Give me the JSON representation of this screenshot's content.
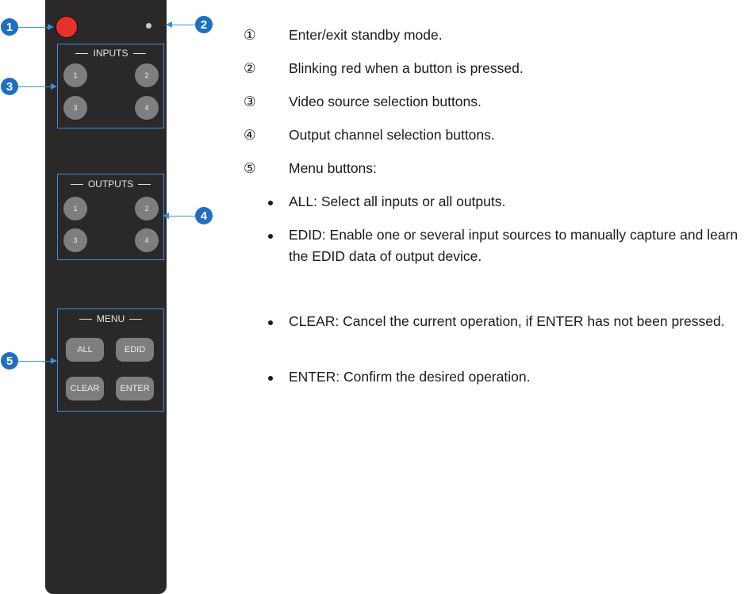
{
  "callouts": [
    "1",
    "2",
    "3",
    "4",
    "5"
  ],
  "remote": {
    "inputs_label": "INPUTS",
    "outputs_label": "OUTPUTS",
    "menu_label": "MENU",
    "input_buttons": [
      "1",
      "2",
      "3",
      "4"
    ],
    "output_buttons": [
      "1",
      "2",
      "3",
      "4"
    ],
    "menu_buttons": [
      "ALL",
      "EDID",
      "CLEAR",
      "ENTER"
    ]
  },
  "legend": {
    "items": [
      {
        "num": "①",
        "text": "Enter/exit standby mode."
      },
      {
        "num": "②",
        "text": "Blinking red when a button is pressed."
      },
      {
        "num": "③",
        "text": "Video source selection buttons."
      },
      {
        "num": "④",
        "text": "Output channel selection buttons."
      },
      {
        "num": "⑤",
        "text": "Menu buttons:"
      }
    ],
    "bullets": [
      "ALL: Select all inputs or all outputs.",
      "EDID: Enable one or several input sources to manually capture and learn the EDID data of output device.",
      "CLEAR: Cancel the current operation, if ENTER has not been pressed.",
      "ENTER: Confirm the desired operation."
    ]
  },
  "colors": {
    "remote_body": "#2a2828",
    "power_button": "#e8312a",
    "callout": "#1f6fc0",
    "frame": "#3e8fd4",
    "button": "#7e7e7e"
  }
}
